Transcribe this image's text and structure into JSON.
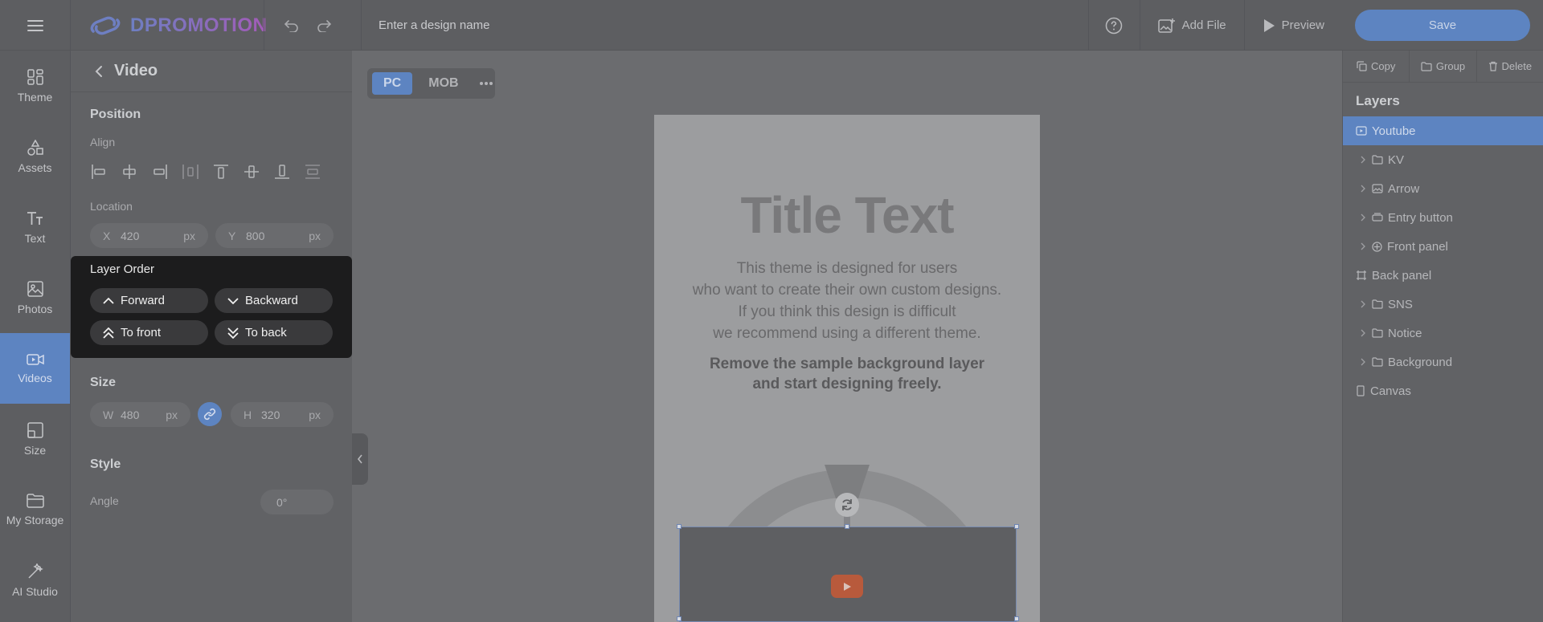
{
  "app": {
    "logo_text": "DPROMOTION"
  },
  "topbar": {
    "design_name_placeholder": "Enter a design name",
    "add_file_label": "Add File",
    "preview_label": "Preview",
    "save_label": "Save"
  },
  "nav": {
    "items": [
      {
        "label": "Theme",
        "icon": "theme-icon"
      },
      {
        "label": "Assets",
        "icon": "assets-icon"
      },
      {
        "label": "Text",
        "icon": "text-icon"
      },
      {
        "label": "Photos",
        "icon": "photos-icon"
      },
      {
        "label": "Videos",
        "icon": "videos-icon",
        "active": true
      },
      {
        "label": "Size",
        "icon": "size-icon"
      },
      {
        "label": "My Storage",
        "icon": "folder-icon"
      },
      {
        "label": "AI Studio",
        "icon": "magic-wand-icon"
      }
    ]
  },
  "panel": {
    "title": "Video",
    "position_title": "Position",
    "align_label": "Align",
    "location_label": "Location",
    "x_label": "X",
    "x_value": "420",
    "y_label": "Y",
    "y_value": "800",
    "unit": "px",
    "size_title": "Size",
    "w_label": "W",
    "w_value": "480",
    "h_label": "H",
    "h_value": "320",
    "style_title": "Style",
    "angle_label": "Angle",
    "angle_value": "0°"
  },
  "layer_order": {
    "title": "Layer Order",
    "forward": "Forward",
    "backward": "Backward",
    "to_front": "To front",
    "to_back": "To back"
  },
  "canvas": {
    "pc_label": "PC",
    "mob_label": "MOB",
    "title_text": "Title Text",
    "body_lines": [
      "This theme is designed for users",
      "who want to create their own custom designs.",
      "If you think this design is difficult",
      "we recommend using a different theme."
    ],
    "strong_lines": [
      "Remove the sample background layer",
      "and start designing freely."
    ]
  },
  "layers_panel": {
    "copy_label": "Copy",
    "group_label": "Group",
    "delete_label": "Delete",
    "title": "Layers",
    "items": [
      {
        "label": "Youtube",
        "icon": "video-icon",
        "selected": true
      },
      {
        "label": "KV",
        "icon": "folder-icon",
        "expandable": true
      },
      {
        "label": "Arrow",
        "icon": "image-icon",
        "expandable": true
      },
      {
        "label": "Entry button",
        "icon": "button-icon",
        "expandable": true
      },
      {
        "label": "Front panel",
        "icon": "component-icon",
        "expandable": true
      },
      {
        "label": "Back panel",
        "icon": "frame-icon"
      },
      {
        "label": "SNS",
        "icon": "folder-icon",
        "expandable": true
      },
      {
        "label": "Notice",
        "icon": "folder-icon",
        "expandable": true
      },
      {
        "label": "Background",
        "icon": "folder-icon",
        "expandable": true
      },
      {
        "label": "Canvas",
        "icon": "canvas-icon"
      }
    ]
  },
  "colors": {
    "accent": "#5d84c1",
    "popup_bg": "#1c1c1d",
    "youtube_red": "#b85a3c"
  }
}
